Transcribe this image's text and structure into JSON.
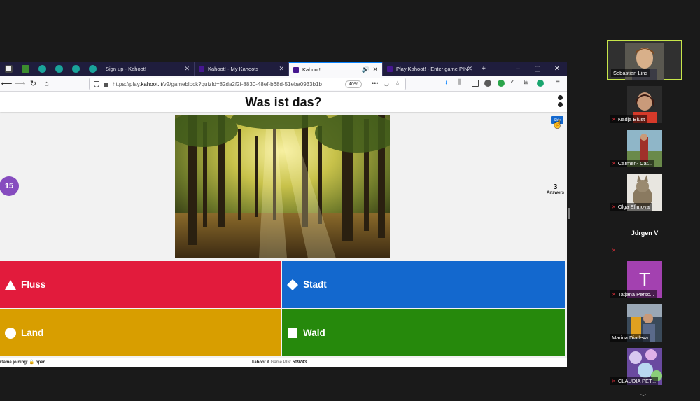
{
  "browser": {
    "tabs": [
      {
        "label": "Sign up - Kahoot!",
        "active": false
      },
      {
        "label": "Kahoot! - My Kahoots",
        "active": false
      },
      {
        "label": "Kahoot!",
        "active": true
      },
      {
        "label": "Play Kahoot! - Enter game PIN",
        "active": false
      }
    ],
    "url_prefix": "https://play.",
    "url_domain": "kahoot.it",
    "url_path": "/v2/gameblock?quizId=82da2f2f-8830-48ef-b68d-51eba0933b1b",
    "zoom": "40%",
    "new_tab": "+",
    "minimize": "–",
    "maximize": "▢",
    "close": "✕"
  },
  "kahoot": {
    "question": "Was ist das?",
    "timer": "15",
    "answers_count": "3",
    "answers_label": "Answers",
    "skip_label": "Skip",
    "answers": [
      {
        "text": "Fluss",
        "shape": "triangle",
        "color": "#e21b3c"
      },
      {
        "text": "Stadt",
        "shape": "diamond",
        "color": "#1368ce"
      },
      {
        "text": "Land",
        "shape": "circle",
        "color": "#d89e00"
      },
      {
        "text": "Wald",
        "shape": "square",
        "color": "#26890c"
      }
    ],
    "footer": {
      "game_joining": "Game joining:",
      "status": "open",
      "site": "kahoot.it",
      "pin_label": "Game PIN:",
      "pin": "509743"
    }
  },
  "participants": [
    {
      "name": "Sebastian Lins",
      "muted": false
    },
    {
      "name": "Nadja Blust",
      "muted": true
    },
    {
      "name": "Carmen- Cat...",
      "muted": true
    },
    {
      "name": "Olga Efimova",
      "muted": true
    },
    {
      "name": "Jürgen V",
      "muted": true
    },
    {
      "name": "Tatjana Persc...",
      "muted": true,
      "initial": "T"
    },
    {
      "name": "Marina Diatleva",
      "muted": false
    },
    {
      "name": "CLAUDIA PET...",
      "muted": true
    }
  ]
}
